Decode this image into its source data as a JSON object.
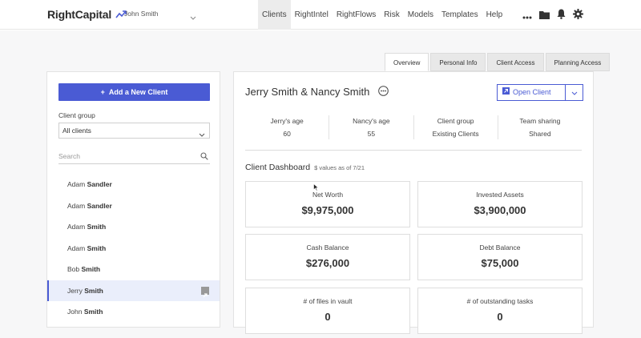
{
  "app": {
    "logo_text": "RightCapital",
    "user_name": "John Smith"
  },
  "nav": {
    "items": [
      {
        "label": "Clients",
        "active": true
      },
      {
        "label": "RightIntel"
      },
      {
        "label": "RightFlows"
      },
      {
        "label": "Risk"
      },
      {
        "label": "Models"
      },
      {
        "label": "Templates"
      },
      {
        "label": "Help"
      }
    ],
    "icons": [
      "more-icon",
      "folder-icon",
      "bell-icon",
      "gear-icon"
    ]
  },
  "tabs": [
    {
      "label": "Overview",
      "active": true
    },
    {
      "label": "Personal Info"
    },
    {
      "label": "Client Access"
    },
    {
      "label": "Planning Access"
    }
  ],
  "left": {
    "add_button": "Add a New Client",
    "client_group_label": "Client group",
    "client_group_value": "All clients",
    "search_placeholder": "Search",
    "clients": [
      {
        "first": "Adam",
        "last": "Sandler"
      },
      {
        "first": "Adam",
        "last": "Sandler"
      },
      {
        "first": "Adam",
        "last": "Smith"
      },
      {
        "first": "Adam",
        "last": "Smith"
      },
      {
        "first": "Bob",
        "last": "Smith"
      },
      {
        "first": "Jerry",
        "last": "Smith",
        "selected": true
      },
      {
        "first": "John",
        "last": "Smith"
      }
    ]
  },
  "client": {
    "name": "Jerry Smith & Nancy Smith",
    "open_button": "Open Client",
    "facts": [
      {
        "label": "Jerry's age",
        "value": "60"
      },
      {
        "label": "Nancy's age",
        "value": "55"
      },
      {
        "label": "Client group",
        "value": "Existing Clients"
      },
      {
        "label": "Team sharing",
        "value": "Shared"
      }
    ]
  },
  "dashboard": {
    "title": "Client Dashboard",
    "subtitle": "$ values as of 7/21",
    "cards": [
      {
        "label": "Net Worth",
        "value": "$9,975,000"
      },
      {
        "label": "Invested Assets",
        "value": "$3,900,000"
      },
      {
        "label": "Cash Balance",
        "value": "$276,000"
      },
      {
        "label": "Debt Balance",
        "value": "$75,000"
      },
      {
        "label": "# of files in vault",
        "value": "0"
      },
      {
        "label": "# of outstanding tasks",
        "value": "0"
      }
    ]
  },
  "colors": {
    "accent": "#4a5bd4",
    "selected_row": "#eaeefb"
  }
}
